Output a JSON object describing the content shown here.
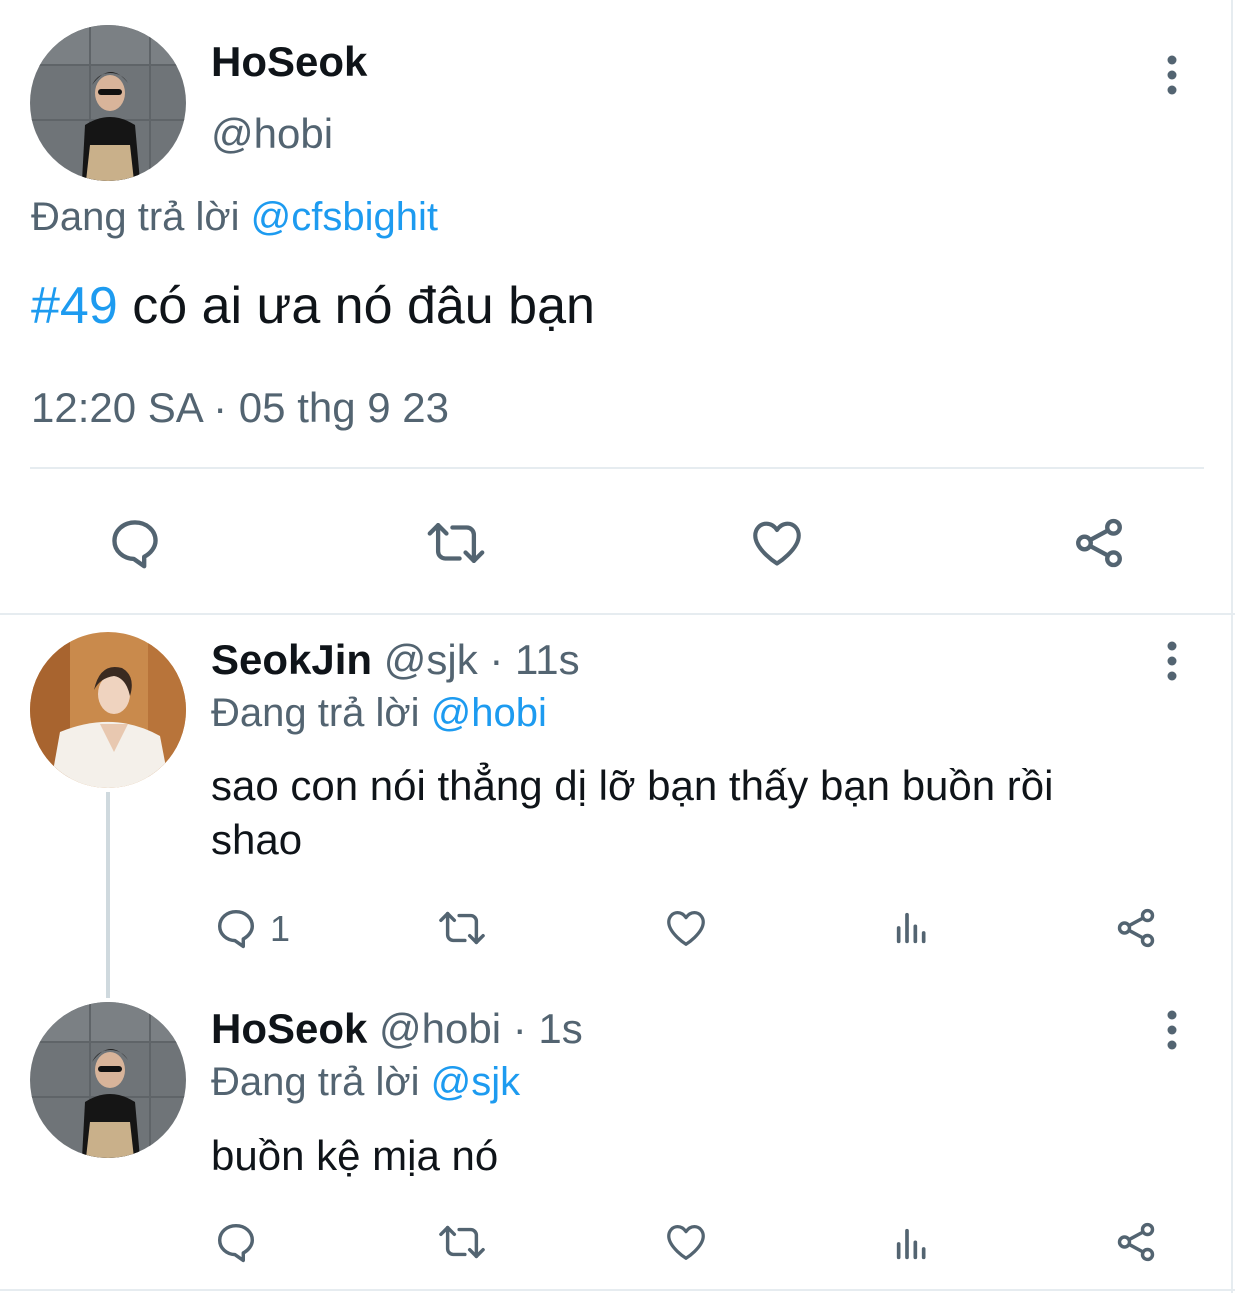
{
  "colors": {
    "accent": "#1d9bf0",
    "muted": "#536471",
    "text": "#0f1419",
    "divider": "#e6ecf0",
    "thread_line": "#cfd9de"
  },
  "main_tweet": {
    "display_name": "HoSeok",
    "handle": "@hobi",
    "replying_prefix": "Đang trả lời",
    "replying_to": "@cfsbighit",
    "hashtag": "#49",
    "text": "có ai ưa nó đâu bạn",
    "timestamp": "12:20 SA · 05 thg 9 23",
    "icons": {
      "more": "more-vertical-icon",
      "reply": "reply-icon",
      "retweet": "retweet-icon",
      "like": "heart-icon",
      "share": "share-icon"
    }
  },
  "replies": [
    {
      "display_name": "SeokJin",
      "handle": "@sjk",
      "time": "· 11s",
      "replying_prefix": "Đang trả lời",
      "replying_to": "@hobi",
      "text_line1": "sao con nói thẳng dị lỡ bạn thấy bạn buồn rồi",
      "text_line2": "shao",
      "reply_count": "1"
    },
    {
      "display_name": "HoSeok",
      "handle": "@hobi",
      "time": "· 1s",
      "replying_prefix": "Đang trả lời",
      "replying_to": "@sjk",
      "text_line1": "buồn kệ mịa nó",
      "reply_count": ""
    }
  ]
}
